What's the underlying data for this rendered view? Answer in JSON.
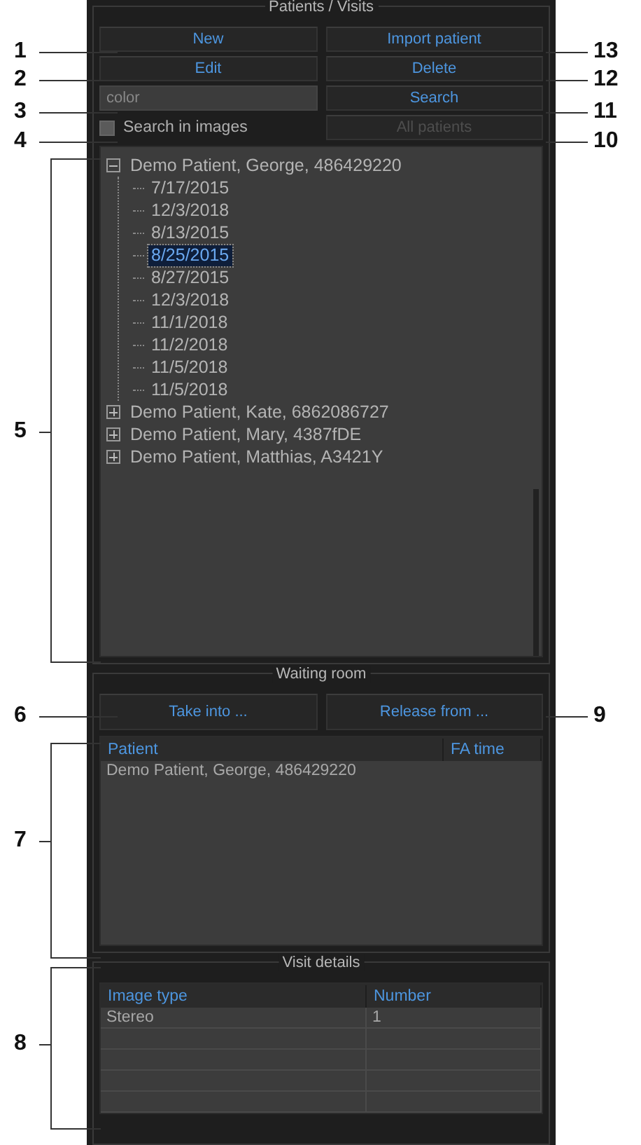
{
  "patients_visits": {
    "title": "Patients / Visits",
    "buttons": [
      {
        "label": "New",
        "disabled": false
      },
      {
        "label": "Import patient",
        "disabled": false
      },
      {
        "label": "Edit",
        "disabled": false
      },
      {
        "label": "Delete",
        "disabled": false
      }
    ],
    "search": {
      "value": "color",
      "button": "Search"
    },
    "search_in_images": {
      "label": "Search in images",
      "checked": false
    },
    "all_patients": {
      "label": "All patients",
      "disabled": true
    },
    "tree": [
      {
        "label": "Demo Patient, George, 486429220",
        "expanded": true,
        "children": [
          {
            "label": "7/17/2015",
            "selected": false
          },
          {
            "label": "12/3/2018",
            "selected": false
          },
          {
            "label": "8/13/2015",
            "selected": false
          },
          {
            "label": "8/25/2015",
            "selected": true
          },
          {
            "label": "8/27/2015",
            "selected": false
          },
          {
            "label": "12/3/2018",
            "selected": false
          },
          {
            "label": "11/1/2018",
            "selected": false
          },
          {
            "label": "11/2/2018",
            "selected": false
          },
          {
            "label": "11/5/2018",
            "selected": false
          },
          {
            "label": "11/5/2018",
            "selected": false
          }
        ]
      },
      {
        "label": "Demo Patient, Kate, 6862086727",
        "expanded": false
      },
      {
        "label": "Demo Patient, Mary, 4387fDE",
        "expanded": false
      },
      {
        "label": "Demo Patient, Matthias, A3421Y",
        "expanded": false
      }
    ]
  },
  "waiting_room": {
    "title": "Waiting room",
    "buttons": [
      "Take into ...",
      "Release from ..."
    ],
    "table": {
      "columns": [
        "Patient",
        "FA time"
      ],
      "rows": [
        [
          "Demo Patient, George, 486429220"
        ]
      ]
    }
  },
  "visit_details": {
    "title": "Visit details",
    "table": {
      "columns": [
        "Image type",
        "Number"
      ],
      "rows": [
        [
          "Stereo",
          "1"
        ]
      ]
    }
  },
  "callouts": [
    {
      "label": "1",
      "kind": "line"
    },
    {
      "label": "13",
      "kind": "line"
    },
    {
      "label": "2",
      "kind": "line"
    },
    {
      "label": "12",
      "kind": "line"
    },
    {
      "label": "3",
      "kind": "line"
    },
    {
      "label": "11",
      "kind": "line"
    },
    {
      "label": "4",
      "kind": "line"
    },
    {
      "label": "10",
      "kind": "line"
    },
    {
      "label": "5",
      "kind": "bracket"
    },
    {
      "label": "6",
      "kind": "line"
    },
    {
      "label": "9",
      "kind": "line"
    },
    {
      "label": "7",
      "kind": "bracket"
    },
    {
      "label": "8",
      "kind": "bracket"
    }
  ]
}
